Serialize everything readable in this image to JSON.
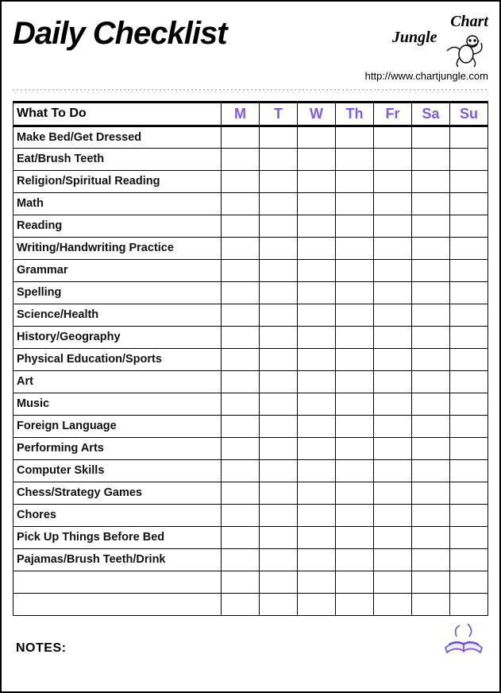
{
  "title": "Daily Checklist",
  "brand": {
    "name_line1": "Chart",
    "name_line2": "Jungle",
    "url": "http://www.chartjungle.com"
  },
  "table": {
    "what_header": "What To Do",
    "days": [
      "M",
      "T",
      "W",
      "Th",
      "Fr",
      "Sa",
      "Su"
    ],
    "tasks": [
      "Make Bed/Get Dressed",
      "Eat/Brush Teeth",
      "Religion/Spiritual Reading",
      "Math",
      "Reading",
      "Writing/Handwriting Practice",
      "Grammar",
      "Spelling",
      "Science/Health",
      "History/Geography",
      "Physical Education/Sports",
      "Art",
      "Music",
      "Foreign Language",
      "Performing Arts",
      "Computer Skills",
      "Chess/Strategy Games",
      "Chores",
      "Pick Up Things Before Bed",
      "Pajamas/Brush Teeth/Drink",
      "",
      ""
    ]
  },
  "notes_label": "NOTES:"
}
